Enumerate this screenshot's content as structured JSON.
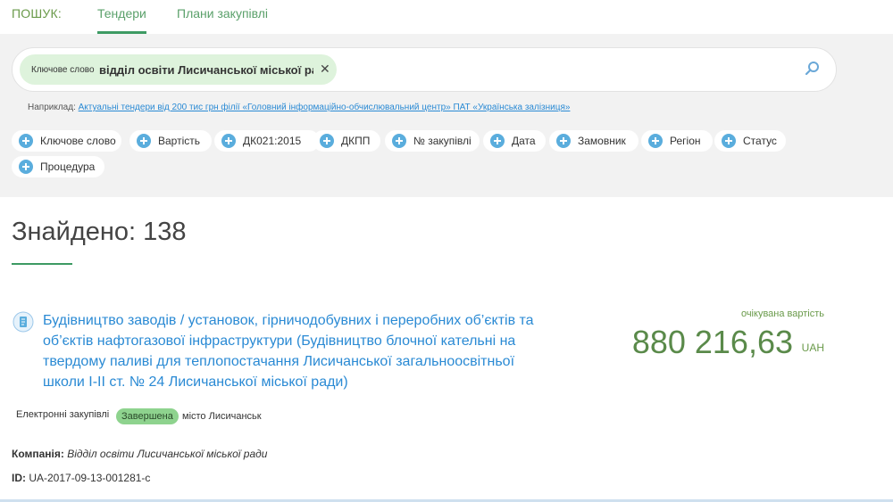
{
  "header": {
    "search_label": "ПОШУК:",
    "tabs": [
      {
        "label": "Тендери",
        "active": true
      },
      {
        "label": "Плани закупівлі",
        "active": false
      }
    ]
  },
  "search": {
    "chip_label": "Ключове слово",
    "chip_value": "відділ освіти Лисичанської міської ради",
    "close_glyph": "✕",
    "search_icon": "magnifier-icon"
  },
  "example": {
    "prefix": "Наприклад:",
    "link": "Актуальні тендери від 200 тис грн філії «Головний інформаційно-обчислювальний центр» ПАТ «Українська залізниця»"
  },
  "filters": [
    "Ключове слово",
    "Вартість",
    "ДК021:2015",
    "ДКПП",
    "№ закупівлі",
    "Дата",
    "Замовник",
    "Регіон",
    "Статус",
    "Процедура"
  ],
  "results": {
    "found_text": "Знайдено: 138"
  },
  "tender": {
    "title": "Будівництво заводів / установок, гірничодобувних і переробних об’єктів та об’єктів нафтогазової інфраструктури (Будівництво блочної кательні на твердому паливі для теплопостачання Лисичанської загальноосвітньої школи І-ІІ ст. № 24 Лисичанської міської ради)",
    "expected_label": "очікувана вартість",
    "amount": "880 216,63",
    "currency": "UAH",
    "procedure": "Електронні закупівлі",
    "status": "Завершена",
    "city": "місто Лисичанськ",
    "company_label": "Компанія:",
    "company": "Відділ освіти Лисичанської міської ради",
    "id_label": "ID:",
    "id": "UA-2017-09-13-001281-c"
  },
  "colors": {
    "accent_green": "#3d9a63",
    "link_blue": "#2a8ad4",
    "badge_green": "#8ed38e",
    "panel_bg": "#f2f2f2"
  }
}
